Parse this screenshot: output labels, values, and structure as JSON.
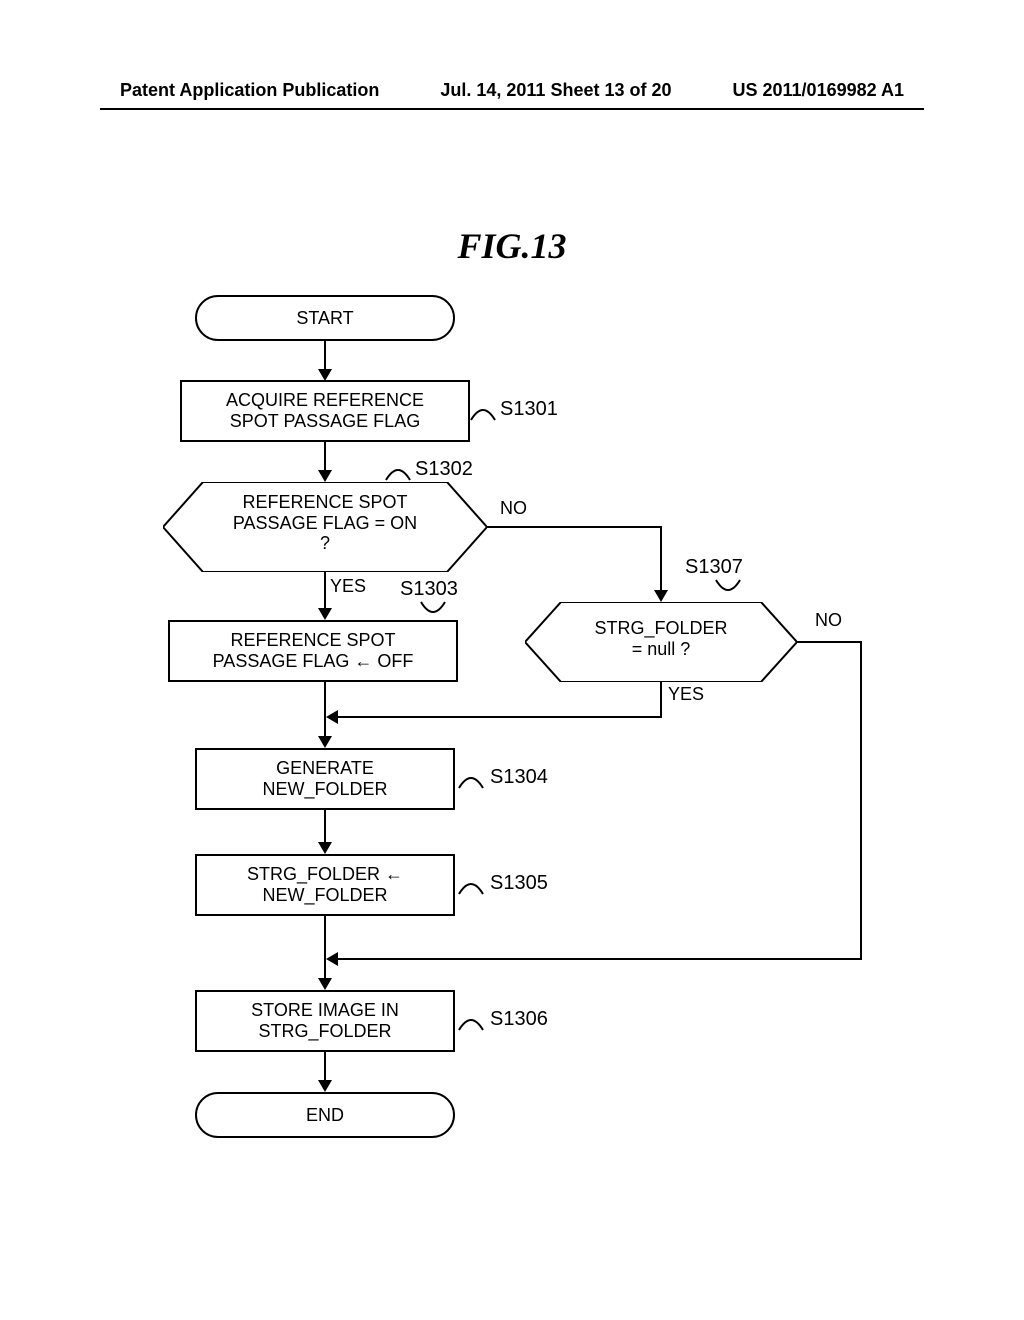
{
  "header": {
    "left": "Patent Application Publication",
    "center": "Jul. 14, 2011  Sheet 13 of 20",
    "right": "US 2011/0169982 A1"
  },
  "figure_title": "FIG.13",
  "nodes": {
    "start": "START",
    "s1301": "ACQUIRE REFERENCE\nSPOT PASSAGE FLAG",
    "s1302": "REFERENCE SPOT\nPASSAGE FLAG = ON\n?",
    "s1303": "REFERENCE SPOT\nPASSAGE FLAG ← OFF",
    "s1304": "GENERATE\nNEW_FOLDER",
    "s1305": "STRG_FOLDER ←\nNEW_FOLDER",
    "s1306": "STORE IMAGE IN\nSTRG_FOLDER",
    "s1307": "STRG_FOLDER\n= null ?",
    "end": "END"
  },
  "step_ids": {
    "s1301": "S1301",
    "s1302": "S1302",
    "s1303": "S1303",
    "s1304": "S1304",
    "s1305": "S1305",
    "s1306": "S1306",
    "s1307": "S1307"
  },
  "branches": {
    "yes": "YES",
    "no": "NO"
  }
}
